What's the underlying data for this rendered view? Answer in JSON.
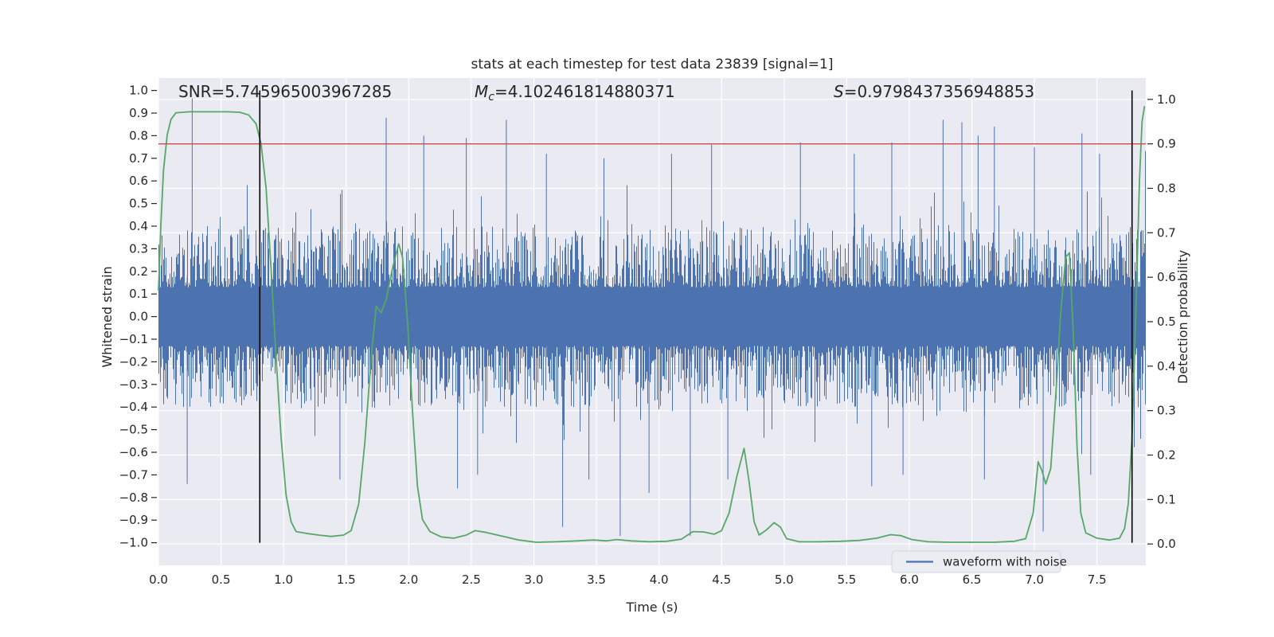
{
  "title": "stats at each timestep for test data 23839 [signal=1]",
  "annotations": {
    "snr": "SNR=5.745965003967285",
    "mc": {
      "m": "M",
      "sub": "c",
      "rest": "=4.102461814880371"
    },
    "s": {
      "s": "S",
      "rest": "=0.9798437356948853"
    }
  },
  "legend": {
    "label": "waveform with noise"
  },
  "colors": {
    "waveform": "#4c72b0",
    "probability": "#55a868",
    "threshold": "#c44e52",
    "event_line": "#000000",
    "axes_bg": "#eaeaf2",
    "grid": "#ffffff",
    "text": "#262626",
    "legend_bg": "#ececf3",
    "legend_border": "#d4d4de"
  },
  "chart_data": {
    "type": "line",
    "title": "stats at each timestep for test data 23839 [signal=1]",
    "xlabel": "Time (s)",
    "ylabel_left": "Whitened strain",
    "ylabel_right": "Detection probability",
    "xlim": [
      0,
      7.89
    ],
    "ylim_left": [
      -1.1,
      1.055
    ],
    "ylim_right": [
      -0.048,
      1.048
    ],
    "grid": {
      "horizontal_axis": "right",
      "vertical_step_s": 0.5,
      "horizontal_step": 0.1
    },
    "x_tick_labels": [
      "0.0",
      "0.5",
      "1.0",
      "1.5",
      "2.0",
      "2.5",
      "3.0",
      "3.5",
      "4.0",
      "4.5",
      "5.0",
      "5.5",
      "6.0",
      "6.5",
      "7.0",
      "7.5"
    ],
    "left_tick_labels": [
      "1.0",
      "0.9",
      "0.8",
      "0.7",
      "0.6",
      "0.5",
      "0.4",
      "0.3",
      "0.2",
      "0.1",
      "0.0",
      "−0.1",
      "−0.2",
      "−0.3",
      "−0.4",
      "−0.5",
      "−0.6",
      "−0.7",
      "−0.8",
      "−0.9",
      "−1.0"
    ],
    "right_tick_labels": [
      "1.0",
      "0.9",
      "0.8",
      "0.7",
      "0.6",
      "0.5",
      "0.4",
      "0.3",
      "0.2",
      "0.1",
      "0.0"
    ],
    "threshold_line": {
      "axis": "right",
      "value": 0.9
    },
    "event_lines_s": [
      0.81,
      7.78
    ],
    "series": [
      {
        "name": "waveform with noise",
        "axis": "left",
        "kind": "noise",
        "noise_params": {
          "seed": 20231123,
          "core_min": 0.13,
          "core_var": 0.27,
          "burst_chance": 0.08,
          "burst_extra": 0.22,
          "rare_chance": 0.011,
          "rare_extra": 0.28,
          "max_amp": 0.97
        },
        "notable_spikes": [
          [
            0.27,
            0.965
          ],
          [
            1.82,
            0.88
          ],
          [
            2.12,
            0.8
          ],
          [
            2.46,
            0.79
          ],
          [
            2.78,
            0.87
          ],
          [
            3.1,
            0.72
          ],
          [
            3.56,
            0.7
          ],
          [
            4.1,
            0.72
          ],
          [
            4.42,
            0.76
          ],
          [
            5.13,
            0.77
          ],
          [
            5.56,
            0.72
          ],
          [
            5.86,
            0.77
          ],
          [
            6.27,
            0.87
          ],
          [
            6.42,
            0.86
          ],
          [
            6.55,
            0.8
          ],
          [
            6.68,
            0.84
          ],
          [
            7.0,
            0.75
          ],
          [
            7.38,
            0.81
          ],
          [
            7.52,
            0.72
          ],
          [
            0.23,
            -0.74
          ],
          [
            1.45,
            -0.72
          ],
          [
            2.39,
            -0.76
          ],
          [
            2.55,
            -0.7
          ],
          [
            3.23,
            -0.93
          ],
          [
            3.44,
            -0.72
          ],
          [
            3.69,
            -0.97
          ],
          [
            3.92,
            -0.78
          ],
          [
            4.25,
            -0.97
          ],
          [
            4.55,
            -0.72
          ],
          [
            5.7,
            -0.75
          ],
          [
            5.95,
            -0.7
          ],
          [
            6.6,
            -0.72
          ],
          [
            7.07,
            -0.95
          ],
          [
            7.45,
            -0.7
          ]
        ]
      },
      {
        "name": "detection probability",
        "axis": "right",
        "kind": "line",
        "points": [
          [
            0,
            0.57
          ],
          [
            0.02,
            0.72
          ],
          [
            0.04,
            0.84
          ],
          [
            0.07,
            0.92
          ],
          [
            0.1,
            0.955
          ],
          [
            0.14,
            0.97
          ],
          [
            0.25,
            0.972
          ],
          [
            0.4,
            0.972
          ],
          [
            0.55,
            0.972
          ],
          [
            0.65,
            0.971
          ],
          [
            0.72,
            0.965
          ],
          [
            0.78,
            0.945
          ],
          [
            0.82,
            0.9
          ],
          [
            0.86,
            0.8
          ],
          [
            0.9,
            0.62
          ],
          [
            0.94,
            0.42
          ],
          [
            0.98,
            0.24
          ],
          [
            1.02,
            0.11
          ],
          [
            1.06,
            0.05
          ],
          [
            1.1,
            0.028
          ],
          [
            1.18,
            0.024
          ],
          [
            1.28,
            0.02
          ],
          [
            1.38,
            0.017
          ],
          [
            1.48,
            0.02
          ],
          [
            1.54,
            0.03
          ],
          [
            1.6,
            0.09
          ],
          [
            1.65,
            0.23
          ],
          [
            1.7,
            0.42
          ],
          [
            1.74,
            0.535
          ],
          [
            1.78,
            0.52
          ],
          [
            1.82,
            0.55
          ],
          [
            1.87,
            0.62
          ],
          [
            1.92,
            0.675
          ],
          [
            1.95,
            0.645
          ],
          [
            1.99,
            0.5
          ],
          [
            2.03,
            0.3
          ],
          [
            2.07,
            0.13
          ],
          [
            2.11,
            0.055
          ],
          [
            2.17,
            0.028
          ],
          [
            2.26,
            0.016
          ],
          [
            2.36,
            0.013
          ],
          [
            2.46,
            0.02
          ],
          [
            2.53,
            0.03
          ],
          [
            2.62,
            0.026
          ],
          [
            2.74,
            0.018
          ],
          [
            2.88,
            0.009
          ],
          [
            3.02,
            0.004
          ],
          [
            3.18,
            0.005
          ],
          [
            3.34,
            0.007
          ],
          [
            3.48,
            0.009
          ],
          [
            3.58,
            0.007
          ],
          [
            3.66,
            0.01
          ],
          [
            3.78,
            0.007
          ],
          [
            3.92,
            0.005
          ],
          [
            4.06,
            0.006
          ],
          [
            4.18,
            0.011
          ],
          [
            4.27,
            0.028
          ],
          [
            4.36,
            0.027
          ],
          [
            4.44,
            0.022
          ],
          [
            4.5,
            0.03
          ],
          [
            4.56,
            0.07
          ],
          [
            4.62,
            0.15
          ],
          [
            4.68,
            0.215
          ],
          [
            4.72,
            0.14
          ],
          [
            4.76,
            0.05
          ],
          [
            4.8,
            0.02
          ],
          [
            4.86,
            0.032
          ],
          [
            4.92,
            0.048
          ],
          [
            4.97,
            0.038
          ],
          [
            5.02,
            0.012
          ],
          [
            5.12,
            0.005
          ],
          [
            5.28,
            0.005
          ],
          [
            5.45,
            0.006
          ],
          [
            5.6,
            0.008
          ],
          [
            5.74,
            0.013
          ],
          [
            5.85,
            0.021
          ],
          [
            5.93,
            0.019
          ],
          [
            6.02,
            0.01
          ],
          [
            6.15,
            0.005
          ],
          [
            6.32,
            0.004
          ],
          [
            6.5,
            0.004
          ],
          [
            6.68,
            0.004
          ],
          [
            6.84,
            0.006
          ],
          [
            6.93,
            0.012
          ],
          [
            6.99,
            0.07
          ],
          [
            7.03,
            0.185
          ],
          [
            7.06,
            0.165
          ],
          [
            7.09,
            0.135
          ],
          [
            7.13,
            0.17
          ],
          [
            7.17,
            0.33
          ],
          [
            7.21,
            0.52
          ],
          [
            7.25,
            0.645
          ],
          [
            7.28,
            0.655
          ],
          [
            7.31,
            0.48
          ],
          [
            7.34,
            0.22
          ],
          [
            7.37,
            0.07
          ],
          [
            7.41,
            0.025
          ],
          [
            7.5,
            0.013
          ],
          [
            7.6,
            0.009
          ],
          [
            7.68,
            0.013
          ],
          [
            7.72,
            0.035
          ],
          [
            7.75,
            0.09
          ],
          [
            7.78,
            0.24
          ],
          [
            7.81,
            0.52
          ],
          [
            7.84,
            0.82
          ],
          [
            7.86,
            0.95
          ],
          [
            7.88,
            0.985
          ]
        ]
      }
    ]
  }
}
